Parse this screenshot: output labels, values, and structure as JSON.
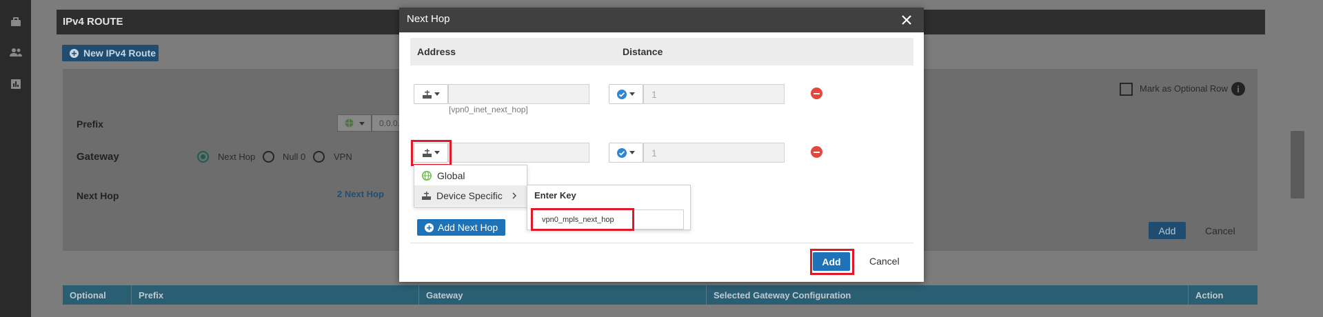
{
  "background": {
    "section_title": "IPv4 ROUTE",
    "new_route_button": "New IPv4 Route",
    "prefix_label": "Prefix",
    "prefix_value": "0.0.0.",
    "gateway_label": "Gateway",
    "gateway_options": [
      "Next Hop",
      "Null 0",
      "VPN"
    ],
    "next_hop_label": "Next Hop",
    "next_hop_link": "2 Next Hop",
    "optional_row_label": "Mark as Optional Row",
    "add_label": "Add",
    "cancel_label": "Cancel",
    "table_columns": [
      "Optional",
      "Prefix",
      "Gateway",
      "Selected Gateway Configuration",
      "Action"
    ]
  },
  "modal": {
    "title": "Next Hop",
    "columns": {
      "address": "Address",
      "distance": "Distance"
    },
    "rows": [
      {
        "address_value": "",
        "hint": "[vpn0_inet_next_hop]",
        "distance_placeholder": "1"
      },
      {
        "address_value": "",
        "hint": "",
        "distance_placeholder": "1"
      }
    ],
    "dropdown": {
      "global": "Global",
      "device_specific": "Device Specific"
    },
    "key_popover": {
      "title": "Enter Key",
      "value": "vpn0_mpls_next_hop"
    },
    "add_next_hop_button": "Add Next Hop",
    "add_button": "Add",
    "cancel_button": "Cancel"
  },
  "colors": {
    "accent": "#1e73b8",
    "highlight": "#e0182a",
    "remove": "#e2483d",
    "check": "#2f86d1",
    "globe": "#6cbf4a"
  }
}
